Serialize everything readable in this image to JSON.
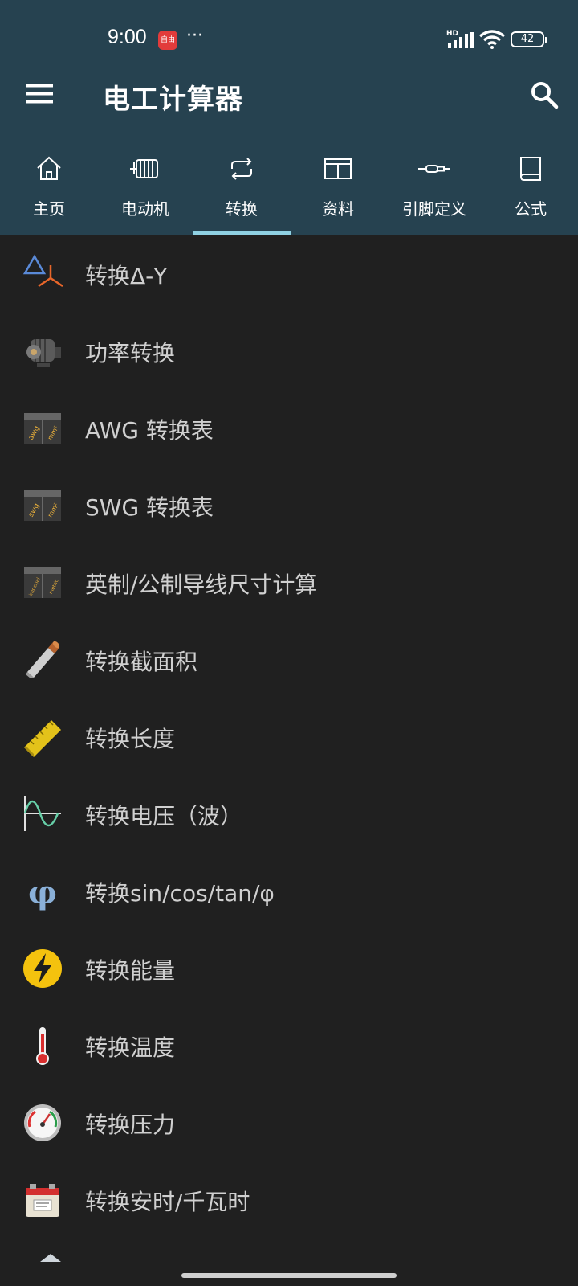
{
  "status_bar": {
    "time": "9:00",
    "notification_app_text": "自由",
    "more": "···",
    "network_type": "HD",
    "battery_level": "42"
  },
  "app_bar": {
    "title": "电工计算器",
    "menu_icon": "hamburger-menu-icon",
    "search_icon": "search-icon"
  },
  "tabs": [
    {
      "label": "主页",
      "icon": "home-icon",
      "active": false
    },
    {
      "label": "电动机",
      "icon": "motor-icon",
      "active": false
    },
    {
      "label": "转换",
      "icon": "convert-icon",
      "active": true
    },
    {
      "label": "资料",
      "icon": "table-icon",
      "active": false
    },
    {
      "label": "引脚定义",
      "icon": "connector-icon",
      "active": false
    },
    {
      "label": "公式",
      "icon": "book-icon",
      "active": false
    }
  ],
  "items": [
    {
      "label": "转换Δ-Y",
      "icon": "delta-y-icon"
    },
    {
      "label": "功率转换",
      "icon": "motor-photo-icon"
    },
    {
      "label": "AWG 转换表",
      "icon": "awg-table-icon",
      "icon_left": "awg",
      "icon_right": "mm²"
    },
    {
      "label": "SWG 转换表",
      "icon": "swg-table-icon",
      "icon_left": "swg",
      "icon_right": "mm²"
    },
    {
      "label": "英制/公制导线尺寸计算",
      "icon": "imperial-metric-icon",
      "icon_left": "imperial",
      "icon_right": "metric"
    },
    {
      "label": "转换截面积",
      "icon": "cable-icon"
    },
    {
      "label": "转换长度",
      "icon": "ruler-icon"
    },
    {
      "label": "转换电压（波）",
      "icon": "sine-wave-icon"
    },
    {
      "label": "转换sin/cos/tan/φ",
      "icon": "phi-icon",
      "icon_text": "φ"
    },
    {
      "label": "转换能量",
      "icon": "lightning-icon"
    },
    {
      "label": "转换温度",
      "icon": "thermometer-icon"
    },
    {
      "label": "转换压力",
      "icon": "gauge-icon"
    },
    {
      "label": "转换安时/千瓦时",
      "icon": "battery-icon"
    }
  ],
  "colors": {
    "appbar": "#264250",
    "background": "#202020",
    "tab_indicator": "#8fd1e3"
  }
}
